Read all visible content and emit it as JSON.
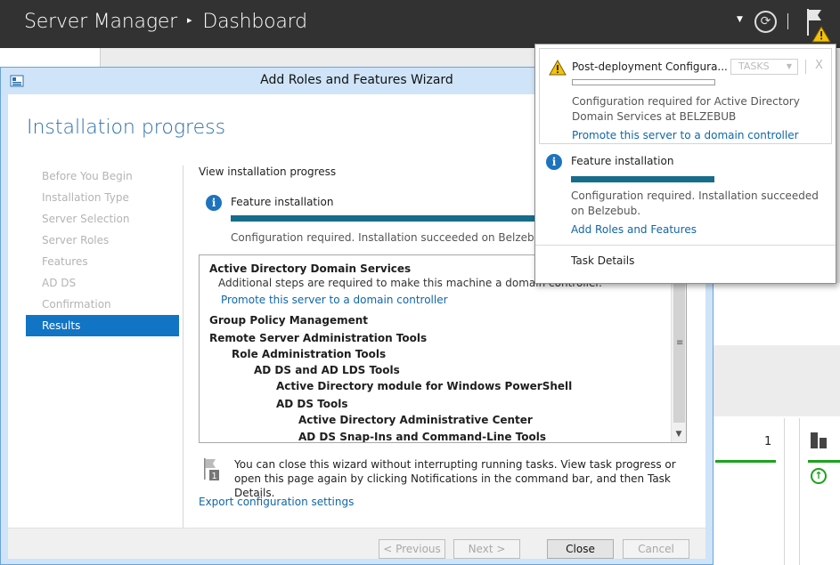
{
  "server_manager": {
    "app_name": "Server Manager",
    "breadcrumb_separator": "▸",
    "current_page": "Dashboard",
    "toolbar": {
      "dropdown_icon": "chevron-down-icon",
      "refresh_icon": "refresh-icon",
      "notifications_icon": "flag-warning-icon"
    },
    "background_tile": {
      "count": "1"
    }
  },
  "wizard": {
    "title": "Add Roles and Features Wizard",
    "heading": "Installation progress",
    "nav": [
      {
        "label": "Before You Begin",
        "active": false
      },
      {
        "label": "Installation Type",
        "active": false
      },
      {
        "label": "Server Selection",
        "active": false
      },
      {
        "label": "Server Roles",
        "active": false
      },
      {
        "label": "Features",
        "active": false
      },
      {
        "label": "AD DS",
        "active": false
      },
      {
        "label": "Confirmation",
        "active": false
      },
      {
        "label": "Results",
        "active": true
      }
    ],
    "content_label": "View installation progress",
    "status": {
      "title": "Feature installation",
      "progress": 1.0,
      "message": "Configuration required. Installation succeeded on Belzebub."
    },
    "results": {
      "adds_title": "Active Directory Domain Services",
      "adds_note": "Additional steps are required to make this machine a domain controller.",
      "adds_link": "Promote this server to a domain controller",
      "gpm": "Group Policy Management",
      "rsat": "Remote Server Administration Tools",
      "role_admin": "Role Administration Tools",
      "adds_lds": "AD DS and AD LDS Tools",
      "ps_module": "Active Directory module for Windows PowerShell",
      "adds_tools": "AD DS Tools",
      "admin_center": "Active Directory Administrative Center",
      "snapins": "AD DS Snap-Ins and Command-Line Tools"
    },
    "hint": "You can close this wizard without interrupting running tasks. View task progress or open this page again by clicking Notifications in the command bar, and then Task Details.",
    "export_link": "Export configuration settings",
    "buttons": {
      "previous": "< Previous",
      "next": "Next >",
      "close": "Close",
      "cancel": "Cancel"
    }
  },
  "notifications": {
    "items": [
      {
        "icon": "warning-icon",
        "title": "Post-deployment Configura...",
        "tasks_label": "TASKS",
        "close_label": "X",
        "progress": 0.0,
        "description": "Configuration required for Active Directory Domain Services at BELZEBUB",
        "link": "Promote this server to a domain controller"
      },
      {
        "icon": "info-icon",
        "title": "Feature installation",
        "progress": 1.0,
        "description": "Configuration required. Installation succeeded on Belzebub.",
        "link": "Add Roles and Features"
      }
    ],
    "task_details": "Task Details"
  },
  "colors": {
    "titlebar": "#323232",
    "accent_blue": "#1174c4",
    "progress_fill": "#166d8a",
    "link": "#1066a8",
    "status_green": "#1ba31b"
  }
}
